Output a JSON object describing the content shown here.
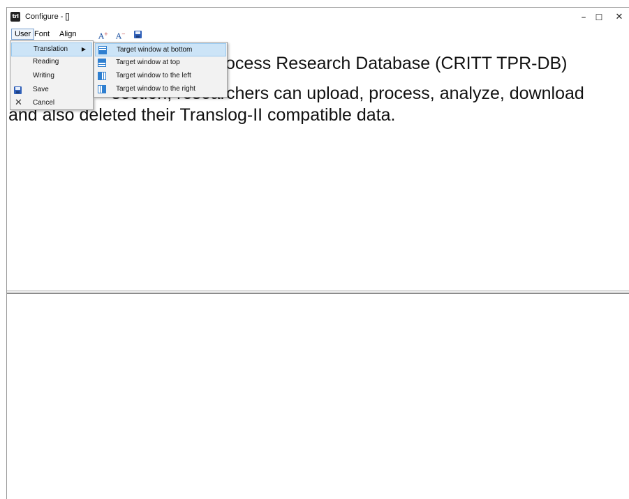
{
  "window": {
    "title": "Configure - []",
    "app_icon_text": "tri",
    "controls": {
      "minimize": "–",
      "maximize": "☐",
      "close": "✕"
    }
  },
  "menubar": {
    "items": [
      "User",
      "Font",
      "Align"
    ],
    "tools": {
      "font_increase": "A",
      "font_decrease": "A",
      "save": "save-icon"
    }
  },
  "user_menu": {
    "items": [
      {
        "label": "Translation",
        "has_submenu": true,
        "icon": ""
      },
      {
        "label": "Reading",
        "icon": ""
      },
      {
        "label": "Writing",
        "icon": ""
      },
      {
        "label": "Save",
        "icon": "save-icon"
      },
      {
        "label": "Cancel",
        "icon": "close-icon"
      }
    ]
  },
  "translation_submenu": {
    "items": [
      {
        "label": "Target window at bottom",
        "icon": "layout-bottom-icon"
      },
      {
        "label": "Target window at top",
        "icon": "layout-top-icon"
      },
      {
        "label": "Target window to the left",
        "icon": "layout-left-icon"
      },
      {
        "label": "Target window to the right",
        "icon": "layout-right-icon"
      }
    ]
  },
  "source_pane": {
    "line1": "ocess Research Database (CRITT TPR-DB)",
    "line2": "section, researchers can upload, process, analyze, download",
    "line3": "and also deleted their Translog-II compatible data."
  },
  "colors": {
    "highlight": "#cce4f7",
    "menu_bg": "#f2f2f2",
    "icon_blue": "#2f5fb8"
  }
}
